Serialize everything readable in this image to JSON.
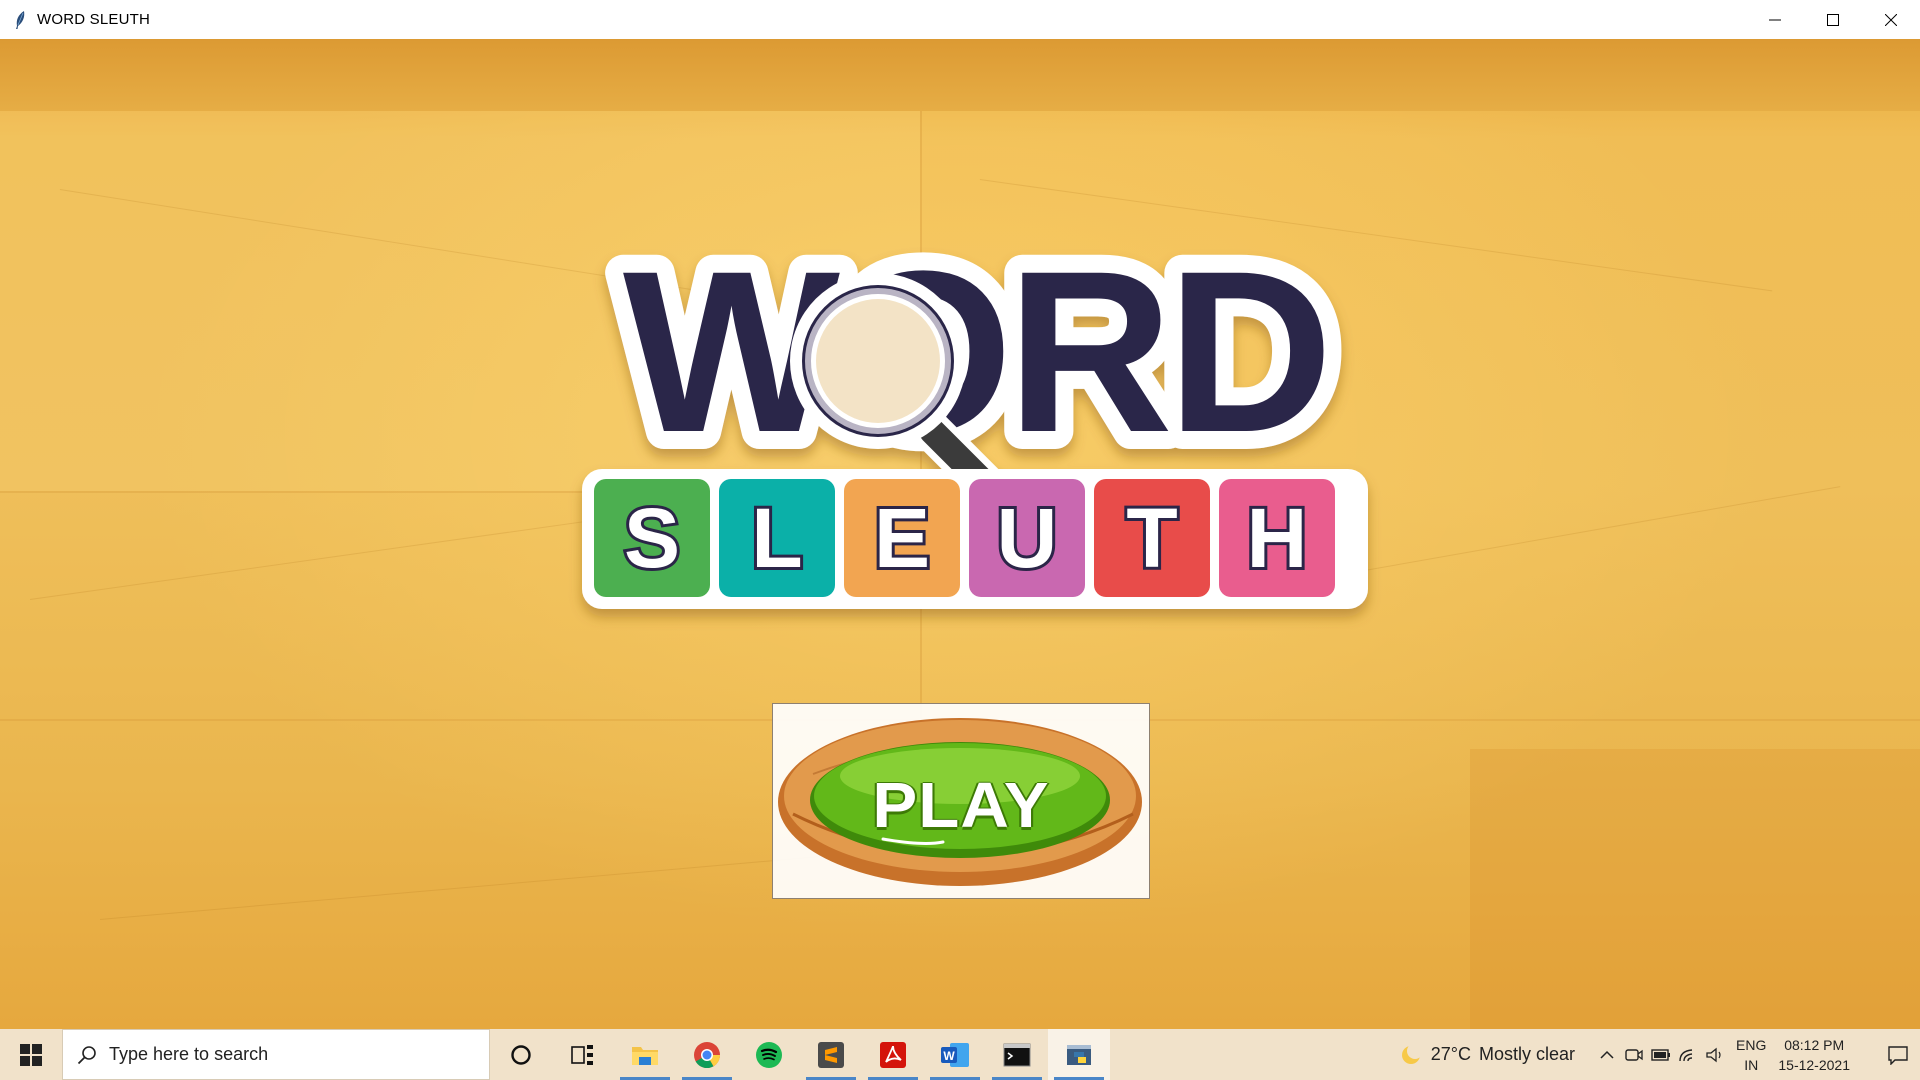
{
  "window": {
    "title": "WORD SLEUTH"
  },
  "logo": {
    "word_top": "WORD",
    "word_bottom": [
      "S",
      "L",
      "E",
      "U",
      "T",
      "H"
    ],
    "tile_colors": [
      "#4caf50",
      "#0bb0a8",
      "#f2a551",
      "#c968b0",
      "#e84c4a",
      "#e95d8e"
    ],
    "ink_color": "#2b2548"
  },
  "play_button": {
    "label": "PLAY"
  },
  "taskbar": {
    "search_placeholder": "Type here to search",
    "apps": [
      "cortana-icon",
      "task-view-icon",
      "file-explorer-icon",
      "chrome-icon",
      "spotify-icon",
      "sublime-text-icon",
      "acrobat-icon",
      "word-icon",
      "terminal-icon",
      "python-icon"
    ],
    "weather": {
      "temp": "27°C",
      "condition": "Mostly clear"
    },
    "language": {
      "line1": "ENG",
      "line2": "IN"
    },
    "clock": {
      "time": "08:12 PM",
      "date": "15-12-2021"
    }
  }
}
